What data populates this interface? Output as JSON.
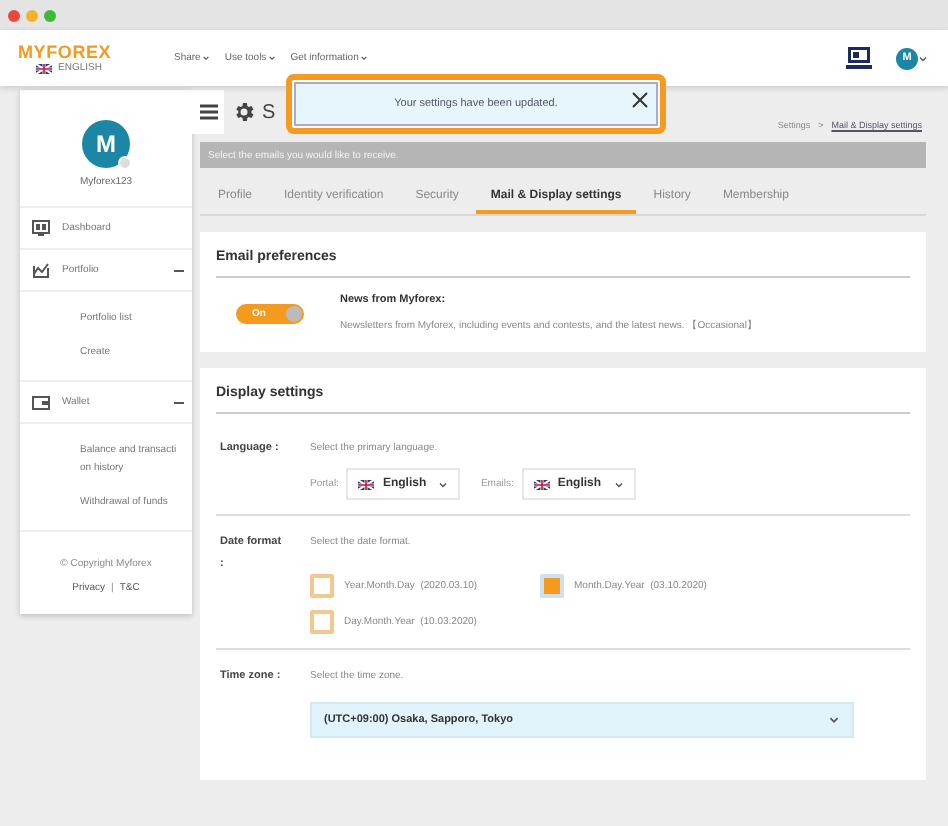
{
  "header": {
    "logo": "MYFOREX",
    "language": "ENGLISH",
    "nav": [
      "Share",
      "Use tools",
      "Get information"
    ],
    "avatar": "M"
  },
  "toast": {
    "message": "Your settings have been updated."
  },
  "sidebar": {
    "avatar": "M",
    "username": "Myforex123",
    "items": [
      {
        "kind": "link",
        "label": "Dashboard"
      },
      {
        "kind": "group",
        "label": "Portfolio",
        "expanded": true,
        "children": [
          {
            "label": "Portfolio list"
          },
          {
            "label": "Create"
          }
        ]
      },
      {
        "kind": "group",
        "label": "Wallet",
        "expanded": true,
        "children": [
          {
            "label": "Balance and transaction history"
          },
          {
            "label": "Withdrawal of funds"
          }
        ]
      }
    ],
    "copyright": "© Copyright Myforex",
    "links": [
      "Privacy",
      "T&C"
    ],
    "link_separator": "|"
  },
  "page": {
    "title": "S",
    "breadcrumb": [
      "Settings",
      "Mail & Display settings"
    ],
    "breadcrumb_separator": ">"
  },
  "notice": "Select the emails you would like to receive.",
  "tabs": [
    {
      "label": "Profile",
      "selected": false
    },
    {
      "label": "Identity verification",
      "selected": false
    },
    {
      "label": "Security",
      "selected": false
    },
    {
      "label": "Mail & Display settings",
      "selected": true
    },
    {
      "label": "History",
      "selected": false
    },
    {
      "label": "Membership",
      "selected": false
    }
  ],
  "email_preferences": {
    "title": "Email preferences",
    "items": [
      {
        "toggle_label": "On",
        "on": true,
        "name": "News from Myforex:",
        "description": "Newsletters from Myforex, including events and contests, and the latest news.",
        "frequency": "【Occasional】"
      }
    ]
  },
  "display_settings": {
    "title": "Display settings",
    "language": {
      "label": "Language :",
      "hint": "Select the primary language.",
      "selects": [
        {
          "label": "Portal:",
          "value": "English"
        },
        {
          "label": "Emails:",
          "value": "English"
        }
      ]
    },
    "date_format": {
      "label": "Date format :",
      "hint": "Select the date format.",
      "options": [
        {
          "label": "Year.Month.Day",
          "example": "(2020.03.10)",
          "selected": false
        },
        {
          "label": "Month.Day.Year",
          "example": "(03.10.2020)",
          "selected": true
        },
        {
          "label": "Day.Month.Year",
          "example": "(10.03.2020)",
          "selected": false
        }
      ]
    },
    "time_zone": {
      "label": "Time zone :",
      "hint": "Select the time zone.",
      "value": "(UTC+09:00) Osaka, Sapporo, Tokyo"
    }
  }
}
